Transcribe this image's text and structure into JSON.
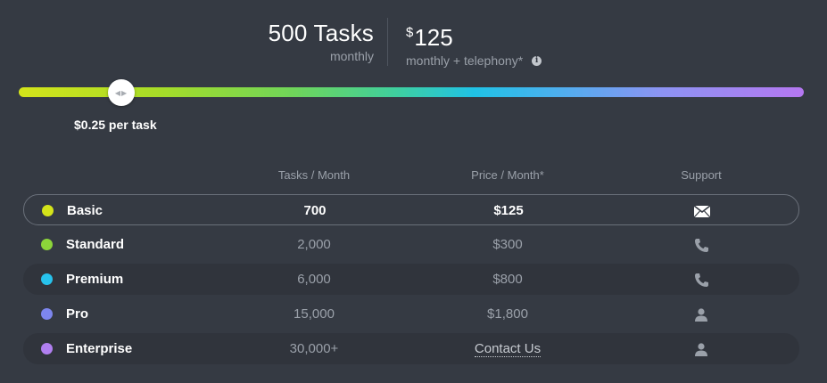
{
  "summary": {
    "tasks": "500 Tasks",
    "tasks_period": "monthly",
    "price_currency": "$",
    "price_amount": "125",
    "price_period": "monthly + telephony*",
    "info_icon": "info-icon"
  },
  "slider": {
    "value_tasks": 500,
    "fraction": 0.125,
    "per_task_label": "$0.25 per task"
  },
  "table": {
    "columns": [
      "Tasks / Month",
      "Price / Month*",
      "Support"
    ],
    "rows": [
      {
        "name": "Basic",
        "tasks": "700",
        "price": "$125",
        "support_icon": "envelope-icon",
        "color": "#d4e41a",
        "selected": true
      },
      {
        "name": "Standard",
        "tasks": "2,000",
        "price": "$300",
        "support_icon": "phone-icon",
        "color": "#8cd53a"
      },
      {
        "name": "Premium",
        "tasks": "6,000",
        "price": "$800",
        "support_icon": "phone-icon",
        "color": "#27c2ec"
      },
      {
        "name": "Pro",
        "tasks": "15,000",
        "price": "$1,800",
        "support_icon": "person-icon",
        "color": "#7d86ee"
      },
      {
        "name": "Enterprise",
        "tasks": "30,000+",
        "price": "Contact Us",
        "support_icon": "person-icon",
        "color": "#b07ff0"
      }
    ]
  }
}
